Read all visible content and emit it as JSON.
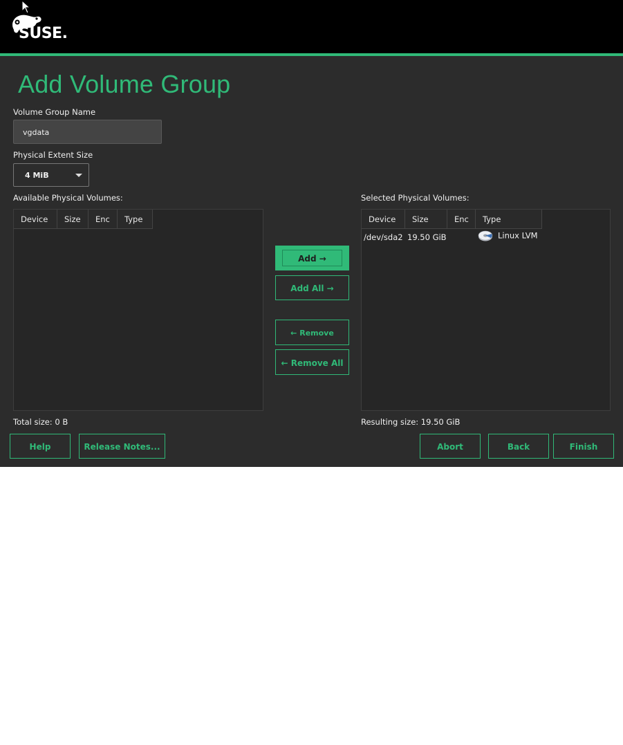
{
  "page": {
    "title": "Add Volume Group"
  },
  "vg_name": {
    "label": "Volume Group Name",
    "value": "vgdata"
  },
  "extent": {
    "label": "Physical Extent Size",
    "value": "4 MiB"
  },
  "available": {
    "label": "Available Physical Volumes:",
    "columns": [
      "Device",
      "Size",
      "Enc",
      "Type"
    ],
    "rows": [],
    "total": "Total size: 0 B"
  },
  "selected": {
    "label": "Selected Physical Volumes:",
    "columns": [
      "Device",
      "Size",
      "Enc",
      "Type"
    ],
    "rows": [
      {
        "device": "/dev/sda2",
        "size": "19.50 GiB",
        "enc": "",
        "type": "Linux LVM",
        "icon": "disk-icon"
      }
    ],
    "total": "Resulting size: 19.50 GiB"
  },
  "transfer": {
    "add": "Add →",
    "add_all": "Add All →",
    "remove": "← Remove",
    "remove_all": "← Remove All"
  },
  "footer": {
    "help": "Help",
    "release_notes": "Release Notes...",
    "abort": "Abort",
    "back": "Back",
    "finish": "Finish"
  },
  "branding": {
    "logo_text": "SUSE.",
    "accent_color": "#30ba78"
  }
}
